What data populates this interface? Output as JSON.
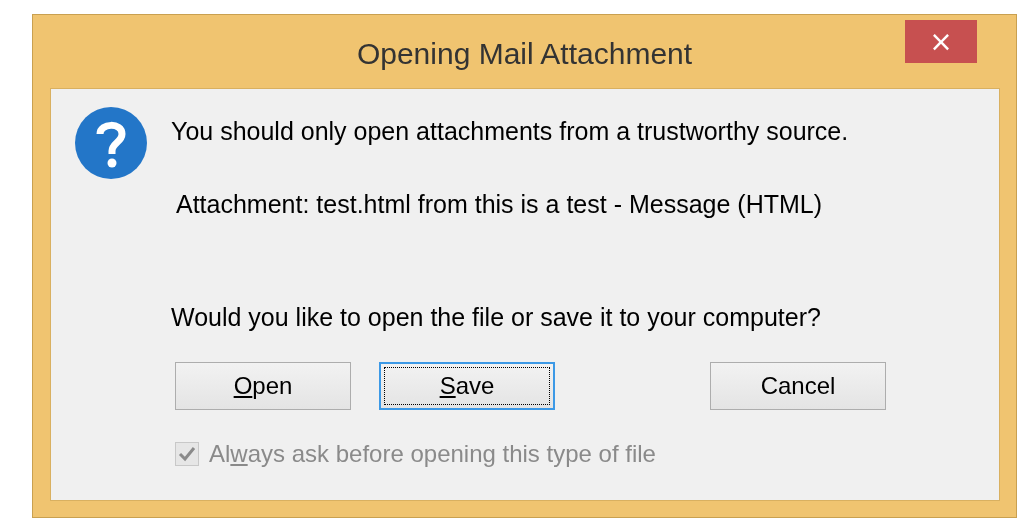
{
  "window": {
    "title": "Opening Mail Attachment",
    "close_label": "×"
  },
  "message": {
    "warning": "You should only open attachments from a trustworthy source.",
    "attachment": "Attachment: test.html from this is a test - Message (HTML)",
    "question": "Would you like to open the file or save it to your computer?"
  },
  "buttons": [
    {
      "label": "Open",
      "focused": false
    },
    {
      "label": "Save",
      "focused": true
    },
    {
      "label": "Cancel",
      "focused": false
    }
  ],
  "always_ask": {
    "label": "Always ask before opening this type of file",
    "checked": true,
    "disabled": true
  }
}
